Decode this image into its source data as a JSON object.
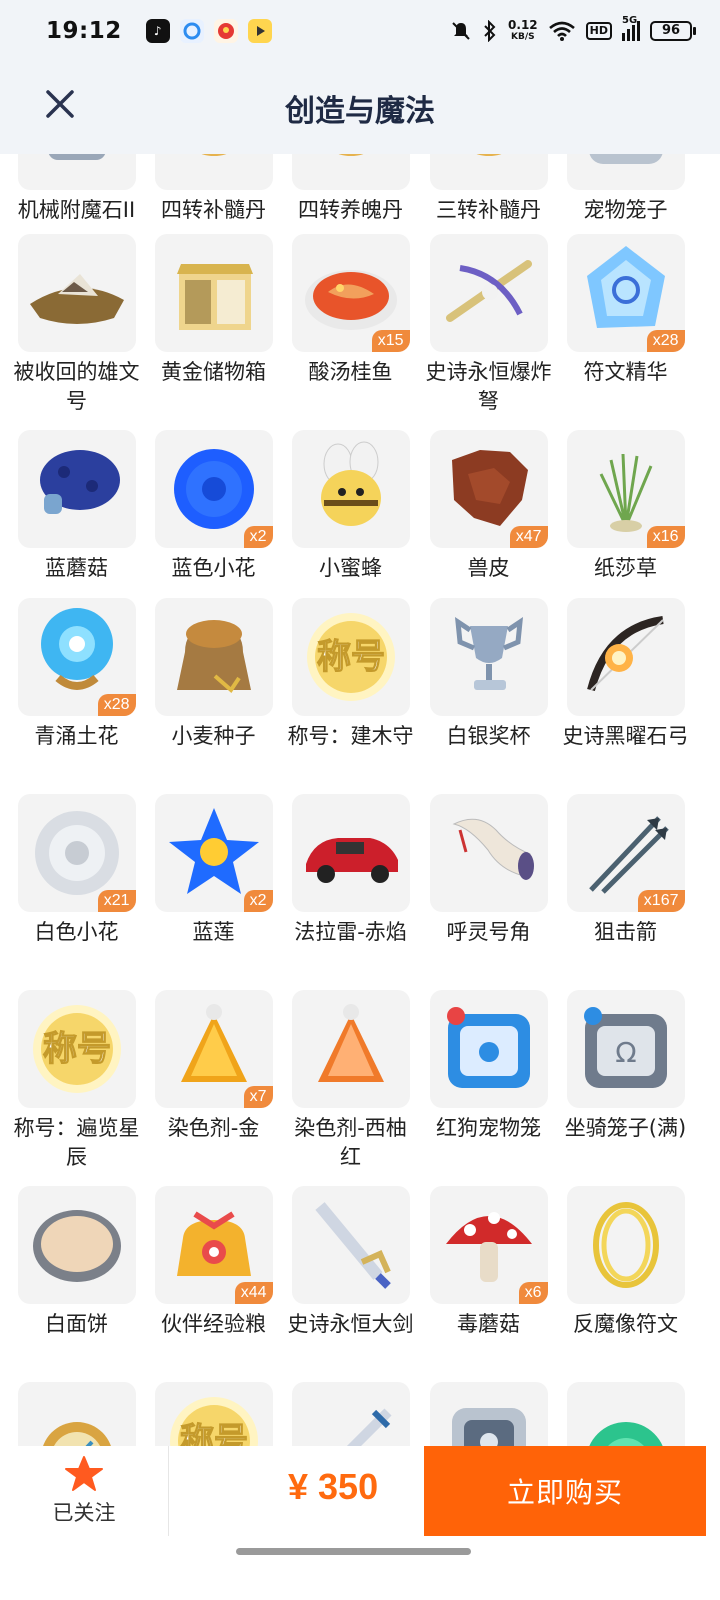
{
  "status_bar": {
    "time": "19:12",
    "net_speed_value": "0.12",
    "net_speed_unit": "KB/S",
    "hd_label": "HD",
    "signal_label": "5G",
    "battery": "96",
    "icons": [
      "tiktok-icon",
      "browser-icon",
      "news-icon",
      "video-icon",
      "mute-icon",
      "bluetooth-icon",
      "wifi-icon",
      "signal-icon",
      "battery-icon"
    ]
  },
  "header": {
    "title": "创造与魔法",
    "close_icon": "close-icon"
  },
  "items": [
    {
      "name": "机械附魔石II",
      "badge": "",
      "icon": "enchant-stone-icon"
    },
    {
      "name": "四转补髓丹",
      "badge": "",
      "icon": "pill-icon"
    },
    {
      "name": "四转养魄丹",
      "badge": "",
      "icon": "pill-icon"
    },
    {
      "name": "三转补髓丹",
      "badge": "",
      "icon": "pill-icon"
    },
    {
      "name": "宠物笼子",
      "badge": "",
      "icon": "pet-cage-icon"
    },
    {
      "name": "被收回的雄文号",
      "badge": "",
      "icon": "ship-icon"
    },
    {
      "name": "黄金储物箱",
      "badge": "",
      "icon": "golden-chest-icon"
    },
    {
      "name": "酸汤桂鱼",
      "badge": "x15",
      "icon": "fish-soup-icon"
    },
    {
      "name": "史诗永恒爆炸弩",
      "badge": "",
      "icon": "crossbow-icon"
    },
    {
      "name": "符文精华",
      "badge": "x28",
      "icon": "rune-essence-icon"
    },
    {
      "name": "蓝蘑菇",
      "badge": "",
      "icon": "blue-mushroom-icon"
    },
    {
      "name": "蓝色小花",
      "badge": "x2",
      "icon": "blue-flower-icon"
    },
    {
      "name": "小蜜蜂",
      "badge": "",
      "icon": "bee-icon"
    },
    {
      "name": "兽皮",
      "badge": "x47",
      "icon": "hide-icon"
    },
    {
      "name": "纸莎草",
      "badge": "x16",
      "icon": "papyrus-icon"
    },
    {
      "name": "青涌土花",
      "badge": "x28",
      "icon": "cyan-flower-icon"
    },
    {
      "name": "小麦种子",
      "badge": "",
      "icon": "seed-bag-icon"
    },
    {
      "name": "称号：建木守",
      "badge": "",
      "icon": "title-icon"
    },
    {
      "name": "白银奖杯",
      "badge": "",
      "icon": "trophy-icon"
    },
    {
      "name": "史诗黑曜石弓",
      "badge": "",
      "icon": "bow-icon"
    },
    {
      "name": "白色小花",
      "badge": "x21",
      "icon": "white-flower-icon"
    },
    {
      "name": "蓝莲",
      "badge": "x2",
      "icon": "blue-lotus-icon"
    },
    {
      "name": "法拉雷-赤焰",
      "badge": "",
      "icon": "red-car-icon"
    },
    {
      "name": "呼灵号角",
      "badge": "",
      "icon": "horn-icon"
    },
    {
      "name": "狙击箭",
      "badge": "x167",
      "icon": "arrow-icon"
    },
    {
      "name": "称号：遍览星辰",
      "badge": "",
      "icon": "title-icon"
    },
    {
      "name": "染色剂-金",
      "badge": "x7",
      "icon": "dye-gold-icon"
    },
    {
      "name": "染色剂-西柚红",
      "badge": "",
      "icon": "dye-red-icon"
    },
    {
      "name": "红狗宠物笼",
      "badge": "",
      "icon": "pet-cage-blue-icon"
    },
    {
      "name": "坐骑笼子(满)",
      "badge": "",
      "icon": "mount-cage-icon"
    },
    {
      "name": "白面饼",
      "badge": "",
      "icon": "flatbread-icon"
    },
    {
      "name": "伙伴经验粮",
      "badge": "x44",
      "icon": "exp-food-bag-icon"
    },
    {
      "name": "史诗永恒大剑",
      "badge": "",
      "icon": "greatsword-icon"
    },
    {
      "name": "毒蘑菇",
      "badge": "x6",
      "icon": "red-mushroom-icon"
    },
    {
      "name": "反魔像符文",
      "badge": "",
      "icon": "gold-rings-icon"
    },
    {
      "name": "",
      "badge": "",
      "icon": "compass-icon"
    },
    {
      "name": "",
      "badge": "",
      "icon": "title-icon"
    },
    {
      "name": "",
      "badge": "",
      "icon": "sword-icon"
    },
    {
      "name": "",
      "badge": "",
      "icon": "pet-cage-icon"
    },
    {
      "name": "",
      "badge": "",
      "icon": "green-flower-icon"
    }
  ],
  "title_badge_text": "称号",
  "bottom_bar": {
    "follow_label": "已关注",
    "follow_icon": "star-icon",
    "price": "¥ 350",
    "buy_label": "立即购买"
  },
  "colors": {
    "accent": "#ff6308",
    "badge": "#f08a3c",
    "header_bg": "#f1f4f8",
    "title_text": "#1f2a44"
  }
}
